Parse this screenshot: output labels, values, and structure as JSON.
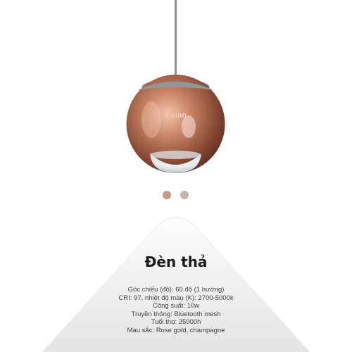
{
  "product": {
    "brand": "LUMI",
    "title": "Đèn thả",
    "specs": [
      "Góc chiếu (độ): 60 độ (1 hướng)",
      "CRI: 97, nhiệt độ màu (K): 2700-5000k",
      "Công suất: 10w",
      "Truyền thông: Bluetooth mesh",
      "Tuổi thọ: 25000h",
      "Màu sắc: Rose gold, champagne"
    ]
  },
  "swatches": [
    {
      "name": "rose-gold",
      "color": "#c89a86"
    },
    {
      "name": "champagne",
      "color": "#c7b4a4"
    }
  ]
}
